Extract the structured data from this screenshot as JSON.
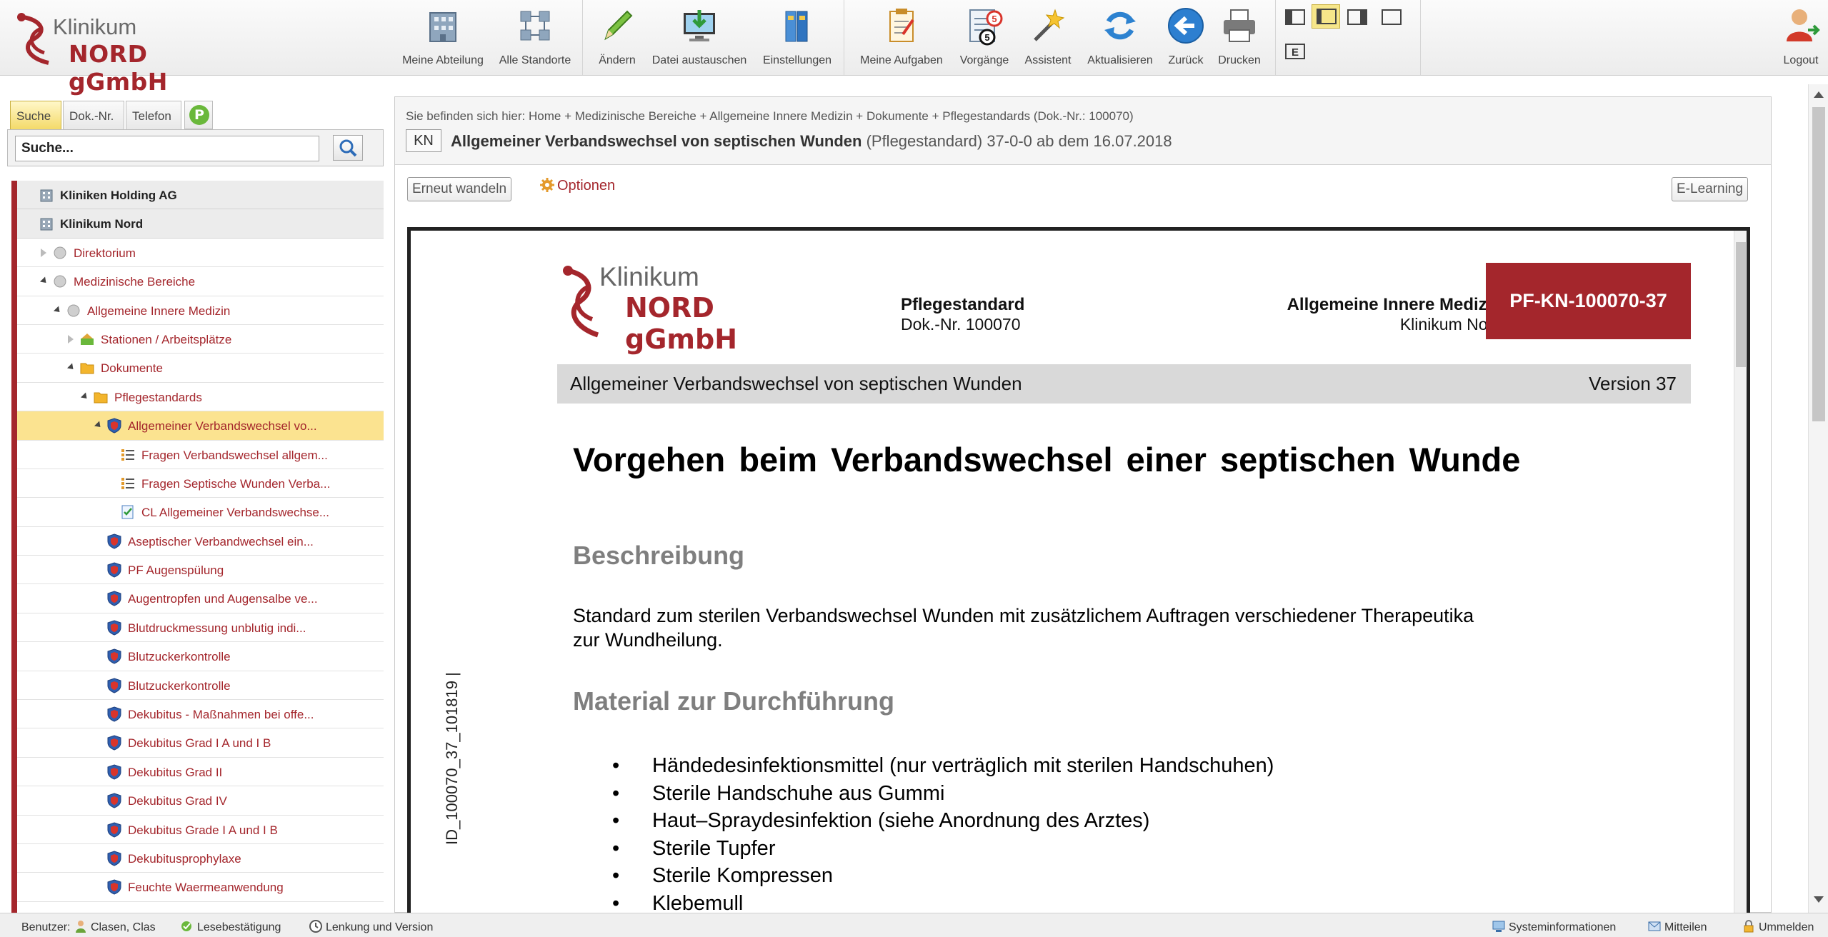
{
  "brand": {
    "line1": "Klinikum",
    "line2": "NORD gGmbH",
    "accent": "#a4262c"
  },
  "toolbar": {
    "meine_abteilung": "Meine Abteilung",
    "alle_standorte": "Alle Standorte",
    "aendern": "Ändern",
    "datei_austauschen": "Datei austauschen",
    "einstellungen": "Einstellungen",
    "meine_aufgaben": "Meine Aufgaben",
    "vorgaenge": "Vorgänge",
    "vorgaenge_badge_red": "5",
    "vorgaenge_badge_black": "5",
    "assistent": "Assistent",
    "aktualisieren": "Aktualisieren",
    "zurueck": "Zurück",
    "drucken": "Drucken",
    "layout_e": "E",
    "logout": "Logout"
  },
  "search": {
    "tabs": [
      "Suche",
      "Dok.-Nr.",
      "Telefon"
    ],
    "placeholder_value": "Suche...",
    "p_tab": "P"
  },
  "tree": [
    {
      "label": "Kliniken Holding AG",
      "icon": "building-icon"
    },
    {
      "label": "Klinikum Nord",
      "icon": "building-icon"
    },
    {
      "label": "Direktorium",
      "icon": "circle-icon"
    },
    {
      "label": "Medizinische Bereiche",
      "icon": "circle-icon"
    },
    {
      "label": "Allgemeine Innere Medizin",
      "icon": "circle-icon"
    },
    {
      "label": "Stationen / Arbeitsplätze",
      "icon": "workplace-icon"
    },
    {
      "label": "Dokumente",
      "icon": "folder-icon"
    },
    {
      "label": "Pflegestandards",
      "icon": "folder-icon"
    },
    {
      "label": "Allgemeiner Verbandswechsel vo...",
      "icon": "shield-icon"
    },
    {
      "label": "Fragen Verbandswechsel allgem...",
      "icon": "list-icon"
    },
    {
      "label": "Fragen Septische Wunden Verba...",
      "icon": "list-icon"
    },
    {
      "label": "CL Allgemeiner Verbandswechse...",
      "icon": "checklist-icon"
    },
    {
      "label": "Aseptischer Verbandwechsel ein...",
      "icon": "shield-icon"
    },
    {
      "label": "PF Augenspülung",
      "icon": "shield-icon"
    },
    {
      "label": "Augentropfen und Augensalbe ve...",
      "icon": "shield-icon"
    },
    {
      "label": "Blutdruckmessung unblutig indi...",
      "icon": "shield-icon"
    },
    {
      "label": "Blutzuckerkontrolle",
      "icon": "shield-icon"
    },
    {
      "label": "Blutzuckerkontrolle",
      "icon": "shield-icon"
    },
    {
      "label": "Dekubitus - Maßnahmen bei offe...",
      "icon": "shield-icon"
    },
    {
      "label": "Dekubitus Grad I A und I B",
      "icon": "shield-icon"
    },
    {
      "label": "Dekubitus Grad II",
      "icon": "shield-icon"
    },
    {
      "label": "Dekubitus Grad IV",
      "icon": "shield-icon"
    },
    {
      "label": "Dekubitus Grade I A und I B",
      "icon": "shield-icon"
    },
    {
      "label": "Dekubitusprophylaxe",
      "icon": "shield-icon"
    },
    {
      "label": "Feuchte Waermeanwendung",
      "icon": "shield-icon"
    }
  ],
  "main": {
    "breadcrumb": "Sie befinden sich hier:  Home + Medizinische Bereiche + Allgemeine Innere Medizin + Dokumente + Pflegestandards (Dok.-Nr.: 100070)",
    "kn": "KN",
    "title": "Allgemeiner Verbandswechsel von septischen Wunden",
    "title_meta": "(Pflegestandard)  37-0-0 ab dem 16.07.2018",
    "btn_wandeln": "Erneut wandeln",
    "btn_optionen": "Optionen",
    "btn_elearning": "E-Learning"
  },
  "document": {
    "side_id": "ID_100070_37_101819 |",
    "logo_line1": "Klinikum",
    "logo_line2": "NORD gGmbH",
    "type": "Pflegestandard",
    "doc_no": "Dok.-Nr. 100070",
    "department": "Allgemeine Innere Medizin",
    "clinic": "Klinikum Nord",
    "code": "PF-KN-100070-37",
    "bar_title": "Allgemeiner Verbandswechsel von septischen Wunden",
    "bar_version": "Version 37",
    "heading": "Vorgehen beim Verbandswechsel einer septischen Wunde",
    "section1": "Beschreibung",
    "description": "Standard zum sterilen Verbandswechsel Wunden mit zusätzlichem Auftragen verschiedener Therapeutika zur Wundheilung.",
    "section2": "Material zur Durchführung",
    "materials": [
      "Händedesinfektionsmittel  (nur verträglich mit sterilen Handschuhen)",
      "Sterile Handschuhe aus Gummi",
      "Haut–Spraydesinfektion  (siehe Anordnung des Arztes)",
      "Sterile Tupfer",
      "Sterile Kompressen",
      "Klebemull"
    ]
  },
  "status": {
    "benutzer_label": "Benutzer:",
    "benutzer_name": "Clasen, Clas",
    "lesebestaetigung": "Lesebestätigung",
    "lenkung": "Lenkung und Version",
    "systeminfo": "Systeminformationen",
    "mitteilen": "Mitteilen",
    "ummelden": "Ummelden"
  }
}
